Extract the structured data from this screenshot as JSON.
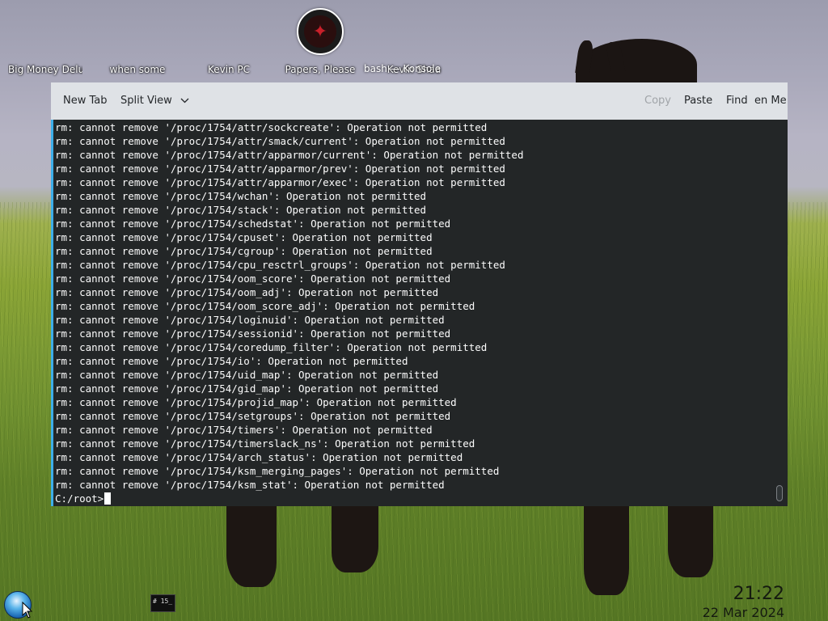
{
  "desktop": {
    "icons": [
      {
        "label": "Big Money Delux"
      },
      {
        "label": "when some"
      },
      {
        "label": "Kevin PC"
      },
      {
        "label": "Papers, Please"
      },
      {
        "label": "Kevin Shaa"
      }
    ],
    "overlay_title": "bash — Konsole"
  },
  "konsole": {
    "toolbar": {
      "new_tab": "New Tab",
      "split_view": "Split View",
      "copy": "Copy",
      "paste": "Paste",
      "find": "Find",
      "menu": "en Me"
    },
    "lines": [
      "rm: cannot remove '/proc/1754/attr/sockcreate': Operation not permitted",
      "rm: cannot remove '/proc/1754/attr/smack/current': Operation not permitted",
      "rm: cannot remove '/proc/1754/attr/apparmor/current': Operation not permitted",
      "rm: cannot remove '/proc/1754/attr/apparmor/prev': Operation not permitted",
      "rm: cannot remove '/proc/1754/attr/apparmor/exec': Operation not permitted",
      "rm: cannot remove '/proc/1754/wchan': Operation not permitted",
      "rm: cannot remove '/proc/1754/stack': Operation not permitted",
      "rm: cannot remove '/proc/1754/schedstat': Operation not permitted",
      "rm: cannot remove '/proc/1754/cpuset': Operation not permitted",
      "rm: cannot remove '/proc/1754/cgroup': Operation not permitted",
      "rm: cannot remove '/proc/1754/cpu_resctrl_groups': Operation not permitted",
      "rm: cannot remove '/proc/1754/oom_score': Operation not permitted",
      "rm: cannot remove '/proc/1754/oom_adj': Operation not permitted",
      "rm: cannot remove '/proc/1754/oom_score_adj': Operation not permitted",
      "rm: cannot remove '/proc/1754/loginuid': Operation not permitted",
      "rm: cannot remove '/proc/1754/sessionid': Operation not permitted",
      "rm: cannot remove '/proc/1754/coredump_filter': Operation not permitted",
      "rm: cannot remove '/proc/1754/io': Operation not permitted",
      "rm: cannot remove '/proc/1754/uid_map': Operation not permitted",
      "rm: cannot remove '/proc/1754/gid_map': Operation not permitted",
      "rm: cannot remove '/proc/1754/projid_map': Operation not permitted",
      "rm: cannot remove '/proc/1754/setgroups': Operation not permitted",
      "rm: cannot remove '/proc/1754/timers': Operation not permitted",
      "rm: cannot remove '/proc/1754/timerslack_ns': Operation not permitted",
      "rm: cannot remove '/proc/1754/arch_status': Operation not permitted",
      "rm: cannot remove '/proc/1754/ksm_merging_pages': Operation not permitted",
      "rm: cannot remove '/proc/1754/ksm_stat': Operation not permitted"
    ],
    "prompt": "C:/root>"
  },
  "taskbar": {
    "thumb_text": "# 15_",
    "time": "21:22",
    "date": "22 Mar 2024"
  },
  "colors": {
    "terminal_bg": "#232627",
    "terminal_fg": "#fcfcfc",
    "toolbar_bg": "#dfe2e6",
    "accent": "#3daee9"
  }
}
